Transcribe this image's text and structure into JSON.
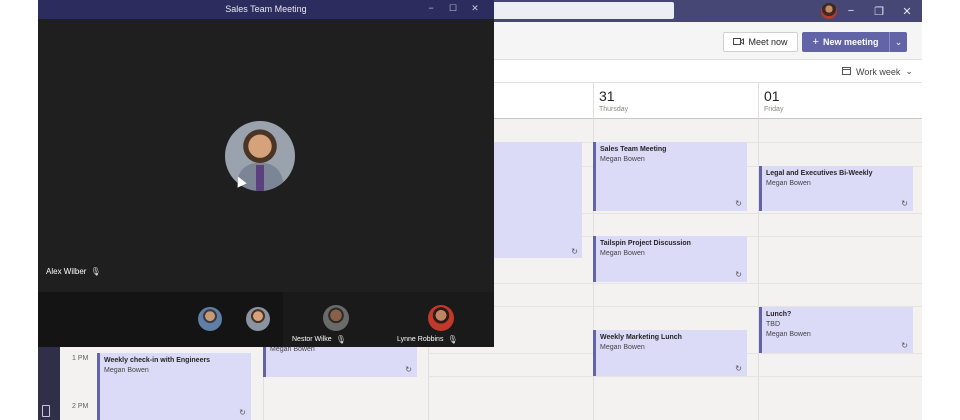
{
  "meeting_window": {
    "title": "Sales Team Meeting",
    "controls": [
      "−",
      "☐",
      "✕"
    ],
    "speaker": "Alex Wilber",
    "participants": [
      {
        "name": "Nestor Wilke"
      },
      {
        "name": "Lynne Robbins"
      }
    ]
  },
  "app": {
    "window_controls": [
      "−",
      "❐",
      "✕"
    ],
    "meet_now_label": "Meet now",
    "new_meeting_label": "New meeting",
    "view_label": "Work week",
    "accent": "#6264a7",
    "header": "#464775"
  },
  "days": [
    {
      "num": "31",
      "name": "Thursday"
    },
    {
      "num": "01",
      "name": "Friday"
    }
  ],
  "times": [
    "1 PM",
    "2 PM"
  ],
  "events": {
    "e1": {
      "title": "Sales Team Meeting",
      "line": "Megan Bowen"
    },
    "e2": {
      "title": "Legal and Executives Bi-Weekly",
      "line": "Megan Bowen"
    },
    "e3": {
      "title": "Tailspin Project Discussion",
      "line": "Megan Bowen"
    },
    "e4": {
      "title": "Lunch?",
      "line": "TBD",
      "line2": "Megan Bowen"
    },
    "e5": {
      "title": "Weekly Marketing Lunch",
      "line": "Megan Bowen"
    },
    "e6": {
      "title": "Weekly check-in with Engineers",
      "line": "Megan Bowen"
    },
    "e7": {
      "line": "Megan Bowen"
    }
  }
}
